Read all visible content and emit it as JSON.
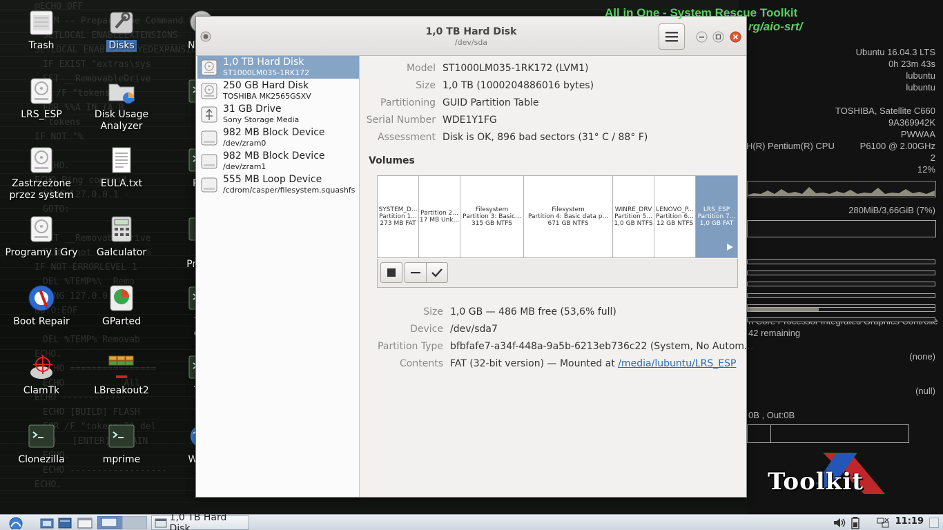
{
  "desktop": {
    "background_script": [
      "@ECHO OFF",
      "REM -- Prepare the Command Processor --",
      "SETLOCAL ENABLEEXTENSIONS",
      "SETLOCAL ENABLEDELAYEDEXPANSION",
      "IF EXIST \"extras\\sys",
      "SET __RemovableDrive",
      "FOR /F \"tokens=2",
      "FOR %%A IN (A B",
      "\"tokens",
      "IF NOT \"%",
      "",
      "ECHO.",
      "ECHO Ping command",
      "PING 127.0.0.1 -",
      "GOTO:",
      "",
      "SET __RemovableDrive",
      "FIND \"not defined\" %",
      "IF NOT ERRORLEVEL 1",
      "DEL %TEMP%\\__Remo",
      "PING 127.0.0.1",
      "GOTO:EOF",
      "",
      "DEL %TEMP% Removab",
      "ECHO.",
      "ECHO ================",
      "ECHO           All",
      "ECHO ------------",
      "ECHO [BUILD] FLASH",
      "FOR /F \"tokens=2\" del",
      "ECHO   [ENTER] - MAIN",
      "ECHO.",
      "ECHO ------------------",
      "ECHO."
    ],
    "icons": [
      {
        "label": "Trash",
        "icon": "trash-icon"
      },
      {
        "label": "Disks",
        "icon": "disks-icon"
      },
      {
        "label": "NT Pa\nR",
        "icon": "nt-password-icon"
      },
      {
        "label": "LRS_ESP",
        "icon": "drive-icon"
      },
      {
        "label": "Disk Usage\nAnalyzer",
        "icon": "disk-usage-icon"
      },
      {
        "label": "nv",
        "icon": "terminal-icon"
      },
      {
        "label": "Zastrzeżone\nprzez system",
        "icon": "drive-icon"
      },
      {
        "label": "EULA.txt",
        "icon": "text-file-icon"
      },
      {
        "label": "Pho",
        "icon": "terminal-icon"
      },
      {
        "label": "Programy i Gry",
        "icon": "drive-icon"
      },
      {
        "label": "Galculator",
        "icon": "calculator-icon"
      },
      {
        "label": "Sy\nProfile",
        "icon": "profile-icon"
      },
      {
        "label": "Boot Repair",
        "icon": "boot-repair-icon"
      },
      {
        "label": "GParted",
        "icon": "gparted-icon"
      },
      {
        "label": "Ter\nem",
        "icon": "terminal-icon"
      },
      {
        "label": "ClamTk",
        "icon": "clamtk-icon"
      },
      {
        "label": "LBreakout2",
        "icon": "lbreakout-icon"
      },
      {
        "label": "Tes",
        "icon": "terminal-icon"
      },
      {
        "label": "Clonezilla",
        "icon": "terminal-icon"
      },
      {
        "label": "mprime",
        "icon": "terminal-icon"
      },
      {
        "label": "Web I",
        "icon": "web-icon"
      }
    ]
  },
  "conky": {
    "title": "All in One - System Rescue Toolkit",
    "url": "rg/aio-srt/",
    "rows": [
      {
        "text": "Ubuntu 16.04.3 LTS"
      },
      {
        "text": "0h 23m 43s"
      },
      {
        "text": "lubuntu"
      },
      {
        "text": "lubuntu"
      },
      {
        "text": "TOSHIBA, Satellite C660"
      },
      {
        "text": "9A369942K"
      },
      {
        "text": "PWWAA"
      },
      {
        "text": "P6100  @ 2.00GHz"
      },
      {
        "text": "2"
      },
      {
        "text": "12%"
      },
      {
        "text": "280MiB/3,66GiB (7%)"
      },
      {
        "text": "(none)"
      },
      {
        "text": "(null)"
      }
    ],
    "cpu_left": "H(R) Pentium(R) CPU",
    "gpu": "n Core Processor Integrated Graphics Controlle",
    "battery": "42 remaining",
    "network": "0B  , Out:0B",
    "bars": [
      0.0,
      0.0,
      0.0,
      0.0,
      0.0,
      0.38,
      0.0
    ],
    "logo_text": "Toolkit"
  },
  "taskbar": {
    "task_label": "1,0 TB Hard Disk",
    "clock": "11:19"
  },
  "window": {
    "title": "1,0 TB Hard Disk",
    "subtitle": "/dev/sda",
    "devices": [
      {
        "name": "1,0 TB Hard Disk",
        "detail": "ST1000LM035-1RK172",
        "selected": true,
        "icon": "hard-disk-icon"
      },
      {
        "name": "250 GB Hard Disk",
        "detail": "TOSHIBA MK2565GSXV",
        "selected": false,
        "icon": "hard-disk-icon"
      },
      {
        "name": "31 GB Drive",
        "detail": "Sony Storage Media",
        "selected": false,
        "icon": "usb-drive-icon"
      },
      {
        "name": "982 MB Block Device",
        "detail": "/dev/zram0",
        "selected": false,
        "icon": "block-device-icon"
      },
      {
        "name": "982 MB Block Device",
        "detail": "/dev/zram1",
        "selected": false,
        "icon": "block-device-icon"
      },
      {
        "name": "555 MB Loop Device",
        "detail": "/cdrom/casper/filesystem.squashfs",
        "selected": false,
        "icon": "block-device-icon"
      }
    ],
    "disk_info": [
      {
        "key": "Model",
        "value": "ST1000LM035-1RK172 (LVM1)"
      },
      {
        "key": "Size",
        "value": "1,0 TB (1000204886016 bytes)"
      },
      {
        "key": "Partitioning",
        "value": "GUID Partition Table"
      },
      {
        "key": "Serial Number",
        "value": "WDE1Y1FG"
      },
      {
        "key": "Assessment",
        "value": "Disk is OK, 896 bad sectors (31° C / 88° F)"
      }
    ],
    "volumes_heading": "Volumes",
    "partitions": [
      {
        "l1": "SYSTEM_D...",
        "l2": "Partition 1...",
        "l3": "273 MB FAT",
        "selected": false
      },
      {
        "l1": "",
        "l2": "Partition 2...",
        "l3": "17 MB Unk...",
        "selected": false
      },
      {
        "l1": "Filesystem",
        "l2": "Partition 3: Basic...",
        "l3": "315 GB NTFS",
        "selected": false
      },
      {
        "l1": "Filesystem",
        "l2": "Partition 4: Basic data p...",
        "l3": "671 GB NTFS",
        "selected": false
      },
      {
        "l1": "WINRE_DRV",
        "l2": "Partition 5...",
        "l3": "1,0 GB NTFS",
        "selected": false
      },
      {
        "l1": "LENOVO_P...",
        "l2": "Partition 6...",
        "l3": "12 GB NTFS",
        "selected": false
      },
      {
        "l1": "LRS_ESP",
        "l2": "Partition 7...",
        "l3": "1,0 GB FAT",
        "selected": true
      }
    ],
    "volume_info": [
      {
        "key": "Size",
        "value": "1,0 GB — 486 MB free (53,6% full)"
      },
      {
        "key": "Device",
        "value": "/dev/sda7"
      },
      {
        "key": "Partition Type",
        "value": "bfbfafe7-a34f-448a-9a5b-6213eb736c22 (System, No Autom..."
      }
    ],
    "contents": {
      "key": "Contents",
      "prefix": "FAT (32-bit version) — Mounted at ",
      "link": "/media/lubuntu/LRS_ESP"
    }
  }
}
